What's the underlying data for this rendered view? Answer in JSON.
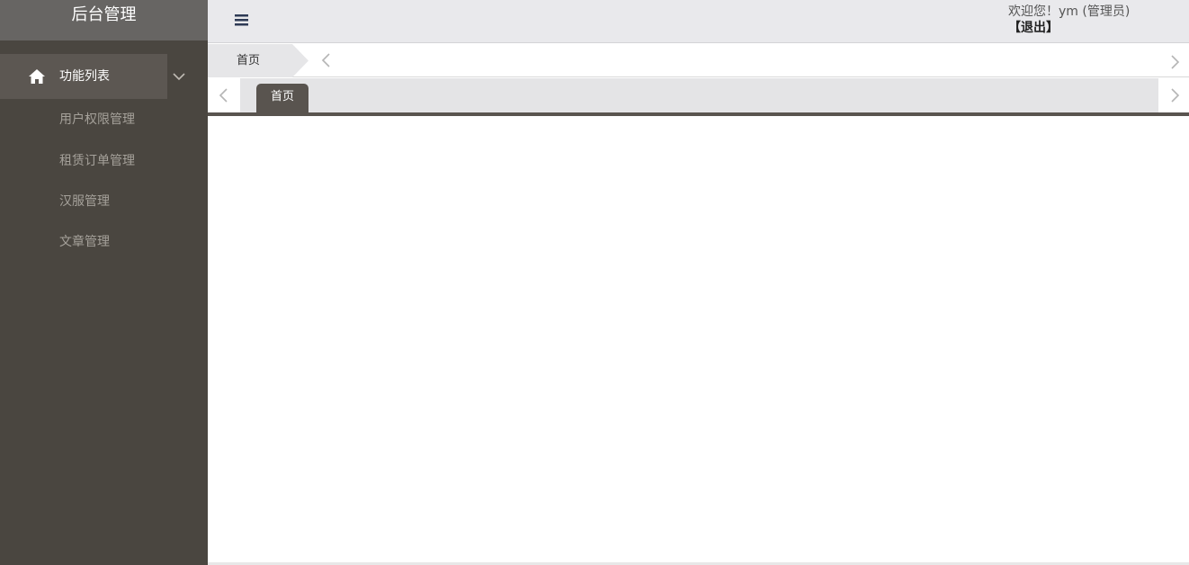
{
  "sidebar": {
    "title": "后台管理",
    "group": {
      "label": "功能列表",
      "icon": "home-icon",
      "chevron_icon": "chevron-down-icon"
    },
    "items": [
      {
        "label": "用户权限管理"
      },
      {
        "label": "租赁订单管理"
      },
      {
        "label": "汉服管理"
      },
      {
        "label": "文章管理"
      }
    ]
  },
  "header": {
    "menu_icon": "hamburger-icon",
    "welcome": "欢迎您！ym (管理员)",
    "logout": "【退出】"
  },
  "breadcrumb": {
    "current": "首页",
    "prev_icon": "chevron-left-icon",
    "next_icon": "chevron-right-icon"
  },
  "tabs": {
    "items": [
      {
        "label": "首页",
        "active": true
      }
    ]
  },
  "colors": {
    "sidebar_bg": "#4a4640",
    "sidebar_header_bg": "#676563",
    "active_group_bg": "#5c5752",
    "submenu_text": "#a5a19a",
    "accent": "#59544f",
    "topbar_bg": "#e9e9ec"
  }
}
